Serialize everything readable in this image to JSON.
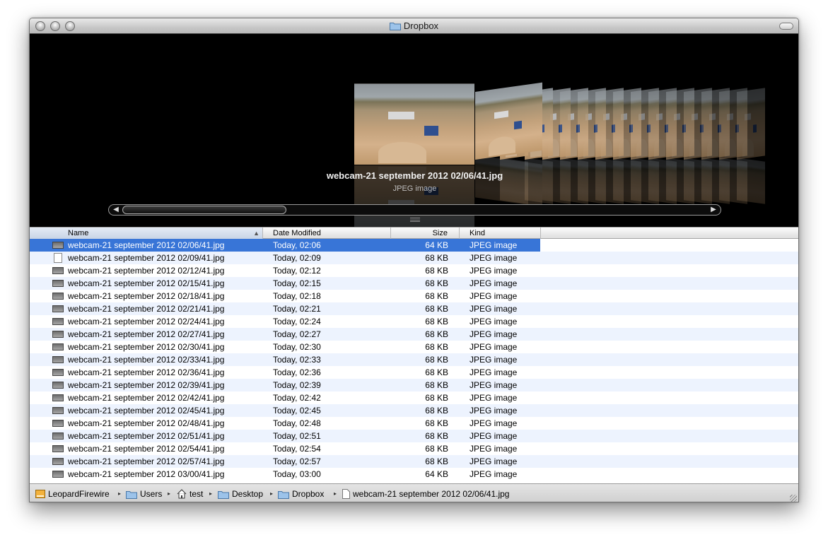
{
  "window": {
    "title": "Dropbox"
  },
  "coverflow": {
    "selected_title": "webcam-21 september 2012 02/06/41.jpg",
    "selected_kind": "JPEG image"
  },
  "columns": {
    "name": "Name",
    "date": "Date Modified",
    "size": "Size",
    "kind": "Kind"
  },
  "files": [
    {
      "name": "webcam-21 september 2012 02/06/41.jpg",
      "date": "Today, 02:06",
      "size": "64 KB",
      "kind": "JPEG image",
      "selected": true
    },
    {
      "name": "webcam-21 september 2012 02/09/41.jpg",
      "date": "Today, 02:09",
      "size": "68 KB",
      "kind": "JPEG image"
    },
    {
      "name": "webcam-21 september 2012 02/12/41.jpg",
      "date": "Today, 02:12",
      "size": "68 KB",
      "kind": "JPEG image"
    },
    {
      "name": "webcam-21 september 2012 02/15/41.jpg",
      "date": "Today, 02:15",
      "size": "68 KB",
      "kind": "JPEG image"
    },
    {
      "name": "webcam-21 september 2012 02/18/41.jpg",
      "date": "Today, 02:18",
      "size": "68 KB",
      "kind": "JPEG image"
    },
    {
      "name": "webcam-21 september 2012 02/21/41.jpg",
      "date": "Today, 02:21",
      "size": "68 KB",
      "kind": "JPEG image"
    },
    {
      "name": "webcam-21 september 2012 02/24/41.jpg",
      "date": "Today, 02:24",
      "size": "68 KB",
      "kind": "JPEG image"
    },
    {
      "name": "webcam-21 september 2012 02/27/41.jpg",
      "date": "Today, 02:27",
      "size": "68 KB",
      "kind": "JPEG image"
    },
    {
      "name": "webcam-21 september 2012 02/30/41.jpg",
      "date": "Today, 02:30",
      "size": "68 KB",
      "kind": "JPEG image"
    },
    {
      "name": "webcam-21 september 2012 02/33/41.jpg",
      "date": "Today, 02:33",
      "size": "68 KB",
      "kind": "JPEG image"
    },
    {
      "name": "webcam-21 september 2012 02/36/41.jpg",
      "date": "Today, 02:36",
      "size": "68 KB",
      "kind": "JPEG image"
    },
    {
      "name": "webcam-21 september 2012 02/39/41.jpg",
      "date": "Today, 02:39",
      "size": "68 KB",
      "kind": "JPEG image"
    },
    {
      "name": "webcam-21 september 2012 02/42/41.jpg",
      "date": "Today, 02:42",
      "size": "68 KB",
      "kind": "JPEG image"
    },
    {
      "name": "webcam-21 september 2012 02/45/41.jpg",
      "date": "Today, 02:45",
      "size": "68 KB",
      "kind": "JPEG image"
    },
    {
      "name": "webcam-21 september 2012 02/48/41.jpg",
      "date": "Today, 02:48",
      "size": "68 KB",
      "kind": "JPEG image"
    },
    {
      "name": "webcam-21 september 2012 02/51/41.jpg",
      "date": "Today, 02:51",
      "size": "68 KB",
      "kind": "JPEG image"
    },
    {
      "name": "webcam-21 september 2012 02/54/41.jpg",
      "date": "Today, 02:54",
      "size": "68 KB",
      "kind": "JPEG image"
    },
    {
      "name": "webcam-21 september 2012 02/57/41.jpg",
      "date": "Today, 02:57",
      "size": "68 KB",
      "kind": "JPEG image"
    },
    {
      "name": "webcam-21 september 2012 03/00/41.jpg",
      "date": "Today, 03:00",
      "size": "64 KB",
      "kind": "JPEG image"
    }
  ],
  "pathbar": [
    {
      "label": "LeopardFirewire",
      "icon": "hard-drive-icon"
    },
    {
      "label": "Users",
      "icon": "folder-icon"
    },
    {
      "label": "test",
      "icon": "home-icon"
    },
    {
      "label": "Desktop",
      "icon": "folder-icon"
    },
    {
      "label": "Dropbox",
      "icon": "folder-icon"
    },
    {
      "label": "webcam-21 september 2012 02/06/41.jpg",
      "icon": "document-icon"
    }
  ],
  "colors": {
    "selection": "#3875d7",
    "alt_row": "#edf3fe",
    "coverflow_bg": "#000000"
  }
}
